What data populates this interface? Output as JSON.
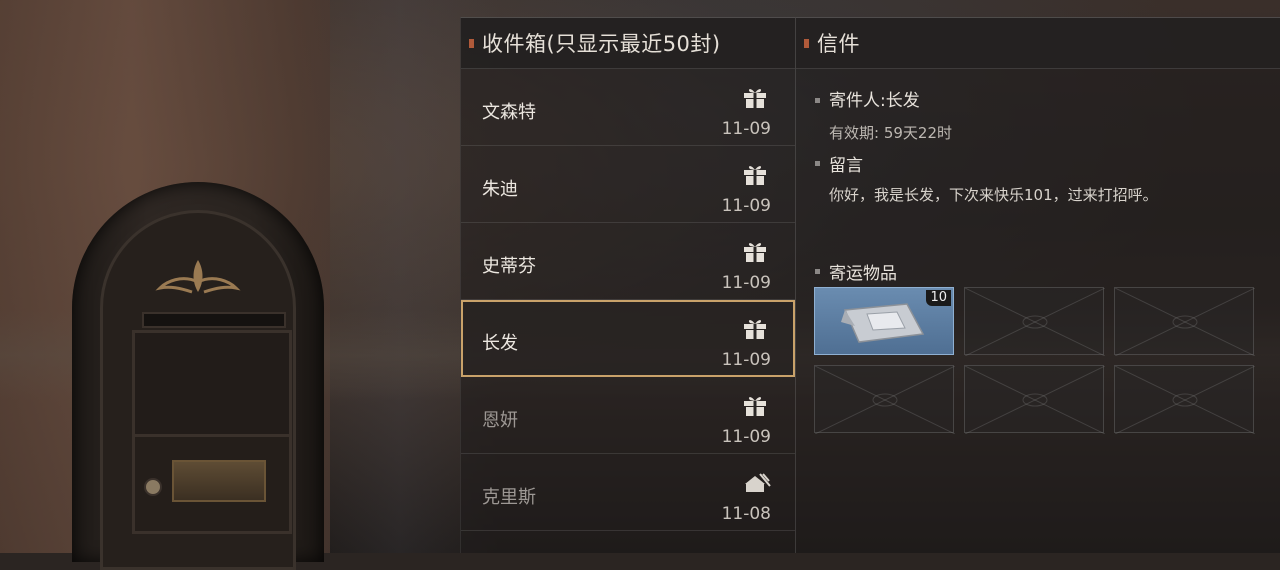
{
  "inbox": {
    "title": "收件箱(只显示最近50封)",
    "items": [
      {
        "sender": "文森特",
        "date": "11-09",
        "icon": "gift-icon",
        "read": false,
        "selected": false
      },
      {
        "sender": "朱迪",
        "date": "11-09",
        "icon": "gift-icon",
        "read": false,
        "selected": false
      },
      {
        "sender": "史蒂芬",
        "date": "11-09",
        "icon": "gift-icon",
        "read": false,
        "selected": false
      },
      {
        "sender": "长发",
        "date": "11-09",
        "icon": "gift-icon",
        "read": false,
        "selected": true
      },
      {
        "sender": "恩妍",
        "date": "11-09",
        "icon": "gift-icon",
        "read": true,
        "selected": false
      },
      {
        "sender": "克里斯",
        "date": "11-08",
        "icon": "gift-claimed-icon",
        "read": true,
        "selected": false
      }
    ]
  },
  "letter": {
    "title": "信件",
    "sender_line": "寄件人:长发",
    "validity": "有效期: 59天22时",
    "message_label": "留言",
    "message": "你好，我是长发，下次来快乐101，过来打招呼。",
    "attachments_label": "寄运物品",
    "attachments": [
      {
        "icon": "supply-bag-icon",
        "count": "10"
      },
      {
        "icon": "empty-slot-icon",
        "count": ""
      },
      {
        "icon": "empty-slot-icon",
        "count": ""
      },
      {
        "icon": "empty-slot-icon",
        "count": ""
      },
      {
        "icon": "empty-slot-icon",
        "count": ""
      },
      {
        "icon": "empty-slot-icon",
        "count": ""
      }
    ]
  },
  "colors": {
    "accent": "#c9a26a",
    "header_marker": "#b05a3a",
    "slot_filled": "#5b7ea3"
  }
}
